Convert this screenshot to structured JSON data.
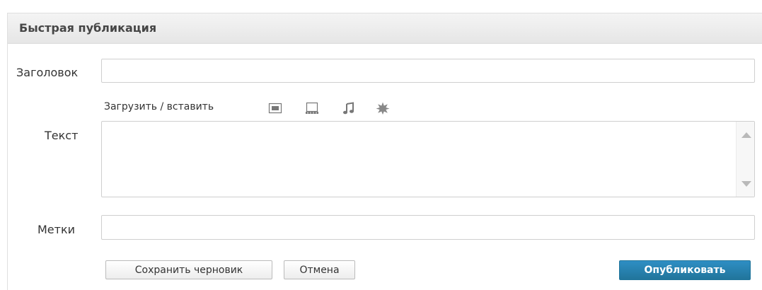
{
  "widget": {
    "title": "Быстрая публикация"
  },
  "form": {
    "title_label": "Заголовок",
    "title_value": "",
    "media_label": "Загрузить / вставить",
    "media_icons": [
      "image-icon",
      "video-icon",
      "audio-icon",
      "media-icon"
    ],
    "text_label": "Текст",
    "text_value": "",
    "tags_label": "Метки",
    "tags_value": ""
  },
  "actions": {
    "save_draft_label": "Сохранить черновик",
    "cancel_label": "Отмена",
    "publish_label": "Опубликовать"
  },
  "colors": {
    "primary": "#21759b",
    "header_bg": "#e9e9e9"
  }
}
